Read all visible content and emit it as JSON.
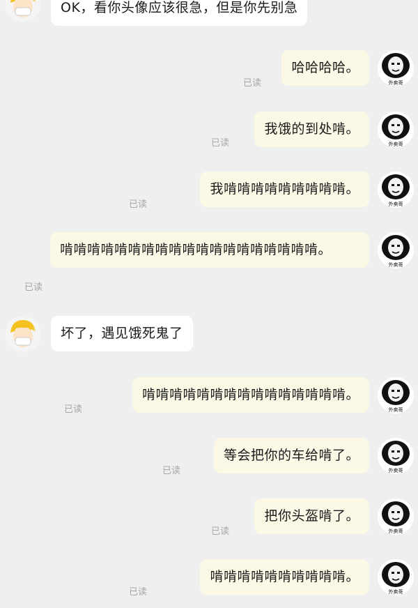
{
  "colors": {
    "background": "#efefef",
    "bubble_self": "#fbf8e6",
    "bubble_other": "#ffffff",
    "read_status": "#a7a7a7"
  },
  "avatars": {
    "other": "cartoon-yellow-hair-masked-face-icon",
    "self": "panda-meme-face-icon",
    "self_caption": "外卖哥"
  },
  "messages": [
    {
      "sender": "other",
      "text": "OK，看你头像应该很急，但是你先别急"
    },
    {
      "sender": "self",
      "text": "哈哈哈哈。",
      "status": "已读"
    },
    {
      "sender": "self",
      "text": "我饿的到处啃。",
      "status": "已读"
    },
    {
      "sender": "self",
      "text": "我啃啃啃啃啃啃啃啃啃。",
      "status": "已读"
    },
    {
      "sender": "self",
      "text": "啃啃啃啃啃啃啃啃啃啃啃啃啃啃啃啃啃啃啃。",
      "status": "已读"
    },
    {
      "sender": "other",
      "text": "坏了，遇见饿死鬼了"
    },
    {
      "sender": "self",
      "text": "啃啃啃啃啃啃啃啃啃啃啃啃啃啃啃。",
      "status": "已读"
    },
    {
      "sender": "self",
      "text": "等会把你的车给啃了。",
      "status": "已读"
    },
    {
      "sender": "self",
      "text": "把你头盔啃了。",
      "status": "已读"
    },
    {
      "sender": "self",
      "text": "啃啃啃啃啃啃啃啃啃啃。",
      "status": "已读"
    }
  ]
}
